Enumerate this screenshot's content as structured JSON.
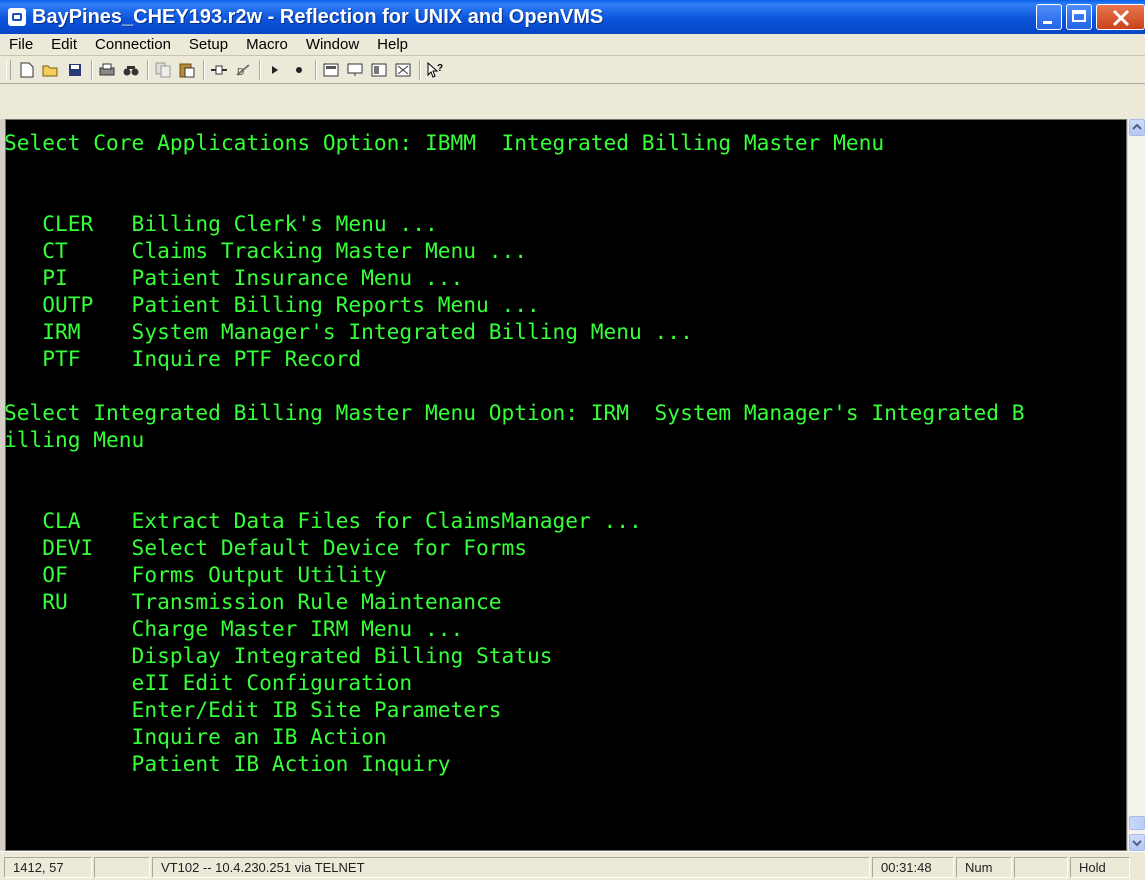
{
  "window": {
    "title": "BayPines_CHEY193.r2w - Reflection for UNIX and OpenVMS"
  },
  "menu": [
    "File",
    "Edit",
    "Connection",
    "Setup",
    "Macro",
    "Window",
    "Help"
  ],
  "toolbar": {
    "icons": [
      "new-icon",
      "open-icon",
      "save-icon",
      "print-icon",
      "find-icon",
      "copy-icon",
      "paste-icon",
      "connect-icon",
      "disconnect-icon",
      "play-macro-icon",
      "record-macro-icon",
      "display-icon",
      "keyboard-icon",
      "setup-icon",
      "settings-icon",
      "help-pointer-icon"
    ]
  },
  "terminal": {
    "lines": [
      "Select Core Applications Option: IBMM  Integrated Billing Master Menu",
      "",
      "",
      "   CLER   Billing Clerk's Menu ...",
      "   CT     Claims Tracking Master Menu ...",
      "   PI     Patient Insurance Menu ...",
      "   OUTP   Patient Billing Reports Menu ...",
      "   IRM    System Manager's Integrated Billing Menu ...",
      "   PTF    Inquire PTF Record",
      "",
      "Select Integrated Billing Master Menu Option: IRM  System Manager's Integrated B",
      "illing Menu",
      "",
      "",
      "   CLA    Extract Data Files for ClaimsManager ...",
      "   DEVI   Select Default Device for Forms",
      "   OF     Forms Output Utility",
      "   RU     Transmission Rule Maintenance",
      "          Charge Master IRM Menu ...",
      "          Display Integrated Billing Status",
      "          eII Edit Configuration",
      "          Enter/Edit IB Site Parameters",
      "          Inquire an IB Action",
      "          Patient IB Action Inquiry",
      ""
    ],
    "text_color": "#36ff3a",
    "background": "#000000"
  },
  "status": {
    "cursor_pos": "1412, 57",
    "connection": "VT102 -- 10.4.230.251 via TELNET",
    "time": "00:31:48",
    "num": "Num",
    "hold": "Hold"
  }
}
